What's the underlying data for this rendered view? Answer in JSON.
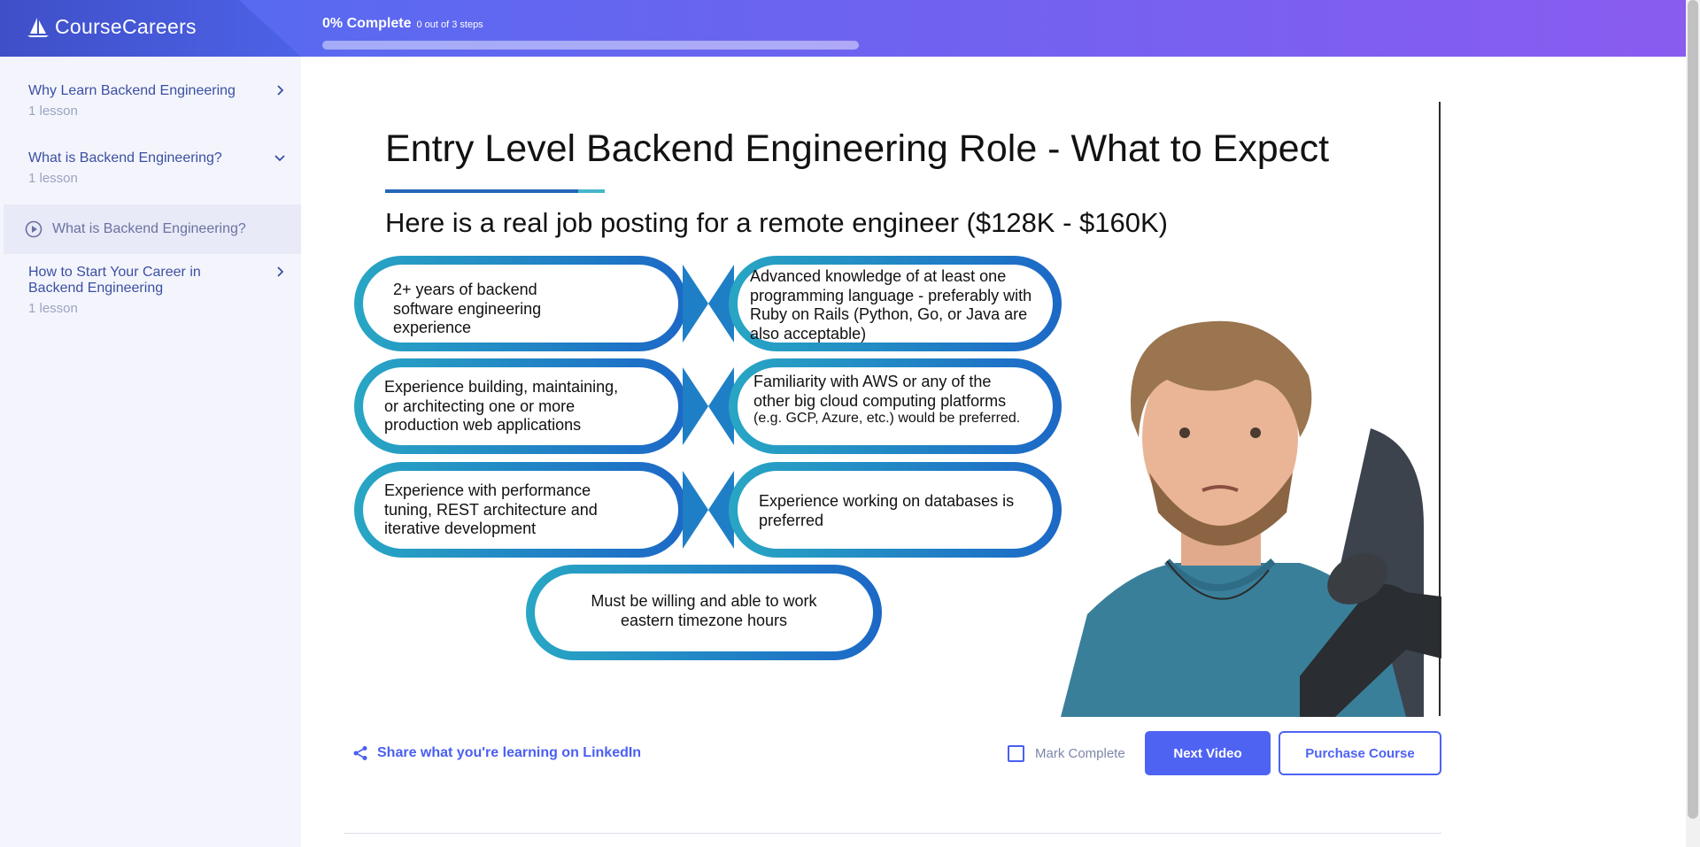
{
  "brand": {
    "name": "CourseCareers"
  },
  "progress": {
    "label": "0% Complete",
    "steps": "0 out of 3 steps",
    "fraction": 0.0
  },
  "sidebar": {
    "sections": [
      {
        "title": "Why Learn Backend Engineering",
        "count": "1 lesson",
        "expanded": false
      },
      {
        "title": "What is Backend Engineering?",
        "count": "1 lesson",
        "expanded": true
      },
      {
        "title": "How to Start Your Career in Backend Engineering",
        "count": "1 lesson",
        "expanded": false
      }
    ],
    "active_lesson": {
      "title": "What is Backend Engineering?"
    }
  },
  "slide": {
    "title": "Entry Level Backend Engineering Role - What to Expect",
    "subtitle": "Here is a real job posting for a remote engineer ($128K - $160K)",
    "requirements": [
      "2+ years of backend software engineering experience",
      "Advanced knowledge of at least one programming language - preferably with Ruby on Rails (Python, Go, or Java are also acceptable)",
      "Experience building, maintaining, or architecting one or more production web applications",
      "Familiarity with AWS or any of the other big cloud computing platforms",
      "(e.g. GCP, Azure, etc.) would be preferred.",
      "Experience with performance tuning, REST architecture and iterative development",
      "Experience working on databases is preferred",
      "Must be willing and able to work eastern timezone hours"
    ]
  },
  "actions": {
    "share_label": "Share what you're learning on LinkedIn",
    "mark_complete_label": "Mark Complete",
    "next_label": "Next Video",
    "purchase_label": "Purchase Course"
  },
  "colors": {
    "primary": "#4f63f3",
    "header_start": "#4f6df0",
    "header_end": "#8a5cf0",
    "sidebar_bg": "#f4f5fc",
    "link": "#3a4fa3"
  },
  "icons": [
    "logo-icon",
    "chevron-right-icon",
    "chevron-down-icon",
    "play-circle-icon",
    "share-icon",
    "checkbox-icon"
  ]
}
